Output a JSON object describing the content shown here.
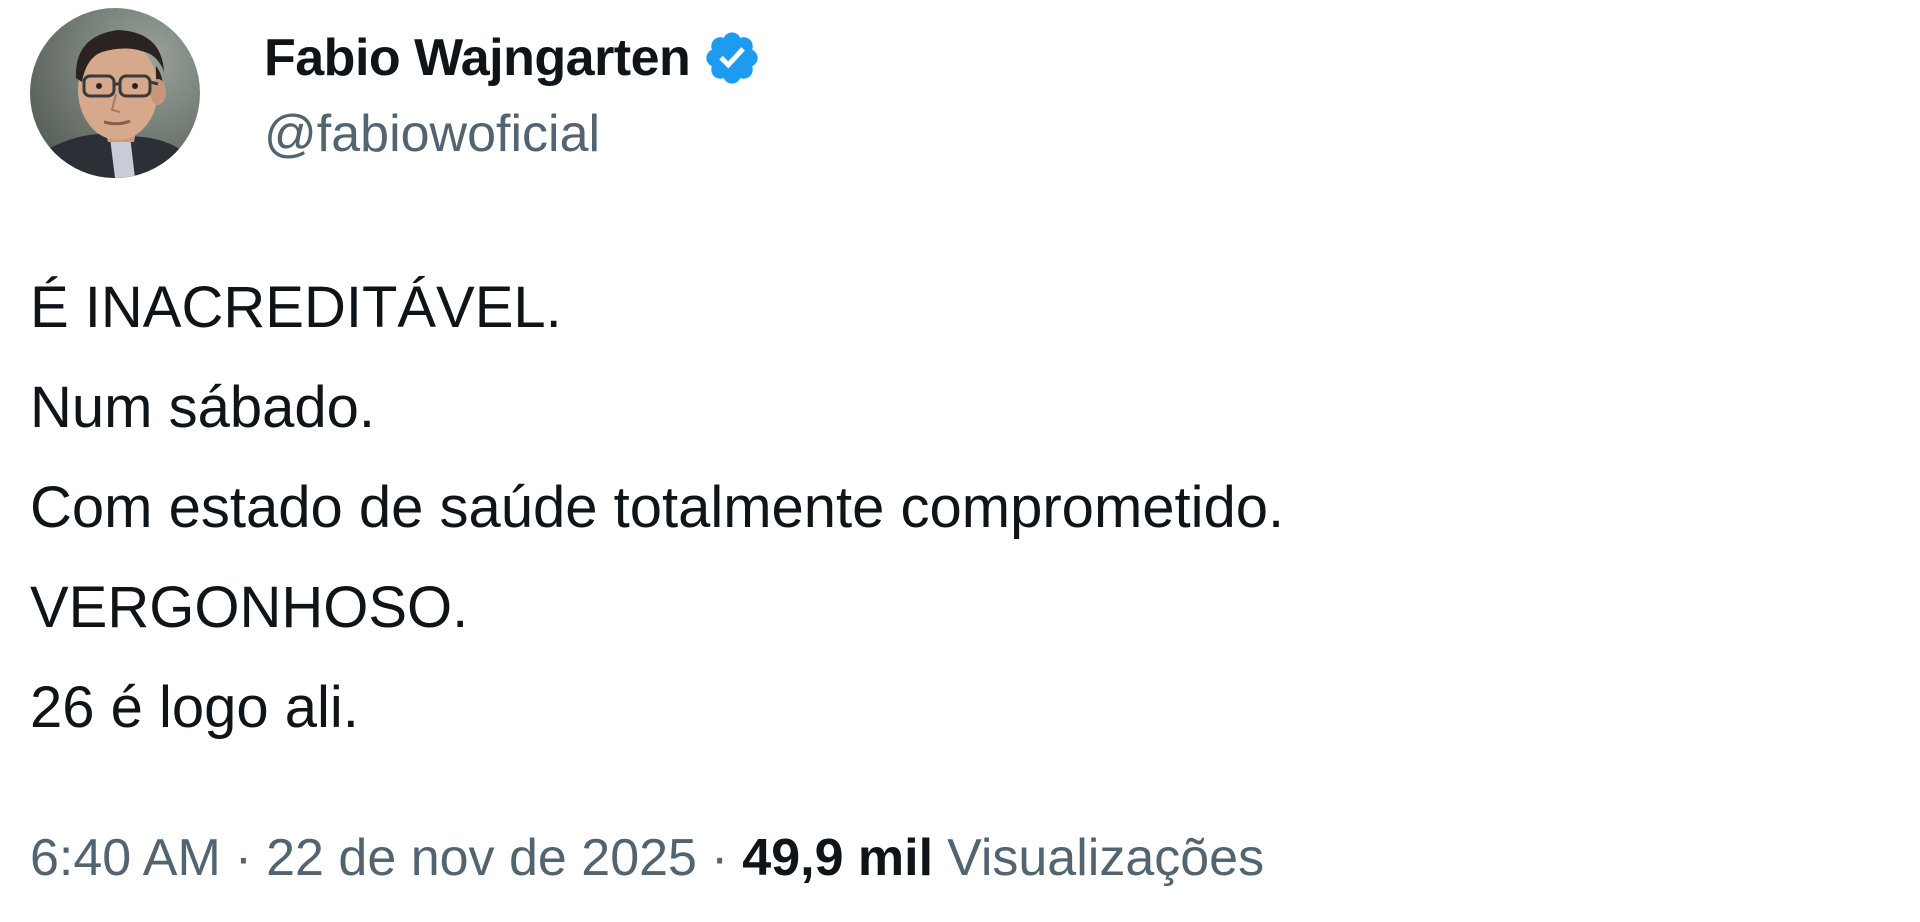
{
  "author": {
    "display_name": "Fabio Wajngarten",
    "handle": "@fabiowoficial",
    "verified_icon": "verified-badge-icon",
    "avatar_icon": "profile-photo"
  },
  "tweet": {
    "lines": [
      "É INACREDITÁVEL.",
      "Num sábado.",
      "Com estado de saúde totalmente comprometido.",
      "VERGONHOSO.",
      "26 é logo ali."
    ]
  },
  "meta": {
    "time": "6:40 AM",
    "separator": "·",
    "date": "22 de nov de 2025",
    "views_count": "49,9 mil",
    "views_label": "Visualizações"
  },
  "colors": {
    "text_primary": "#0f1419",
    "text_secondary": "#536471",
    "verified_blue": "#1d9bf0",
    "background": "#ffffff"
  }
}
